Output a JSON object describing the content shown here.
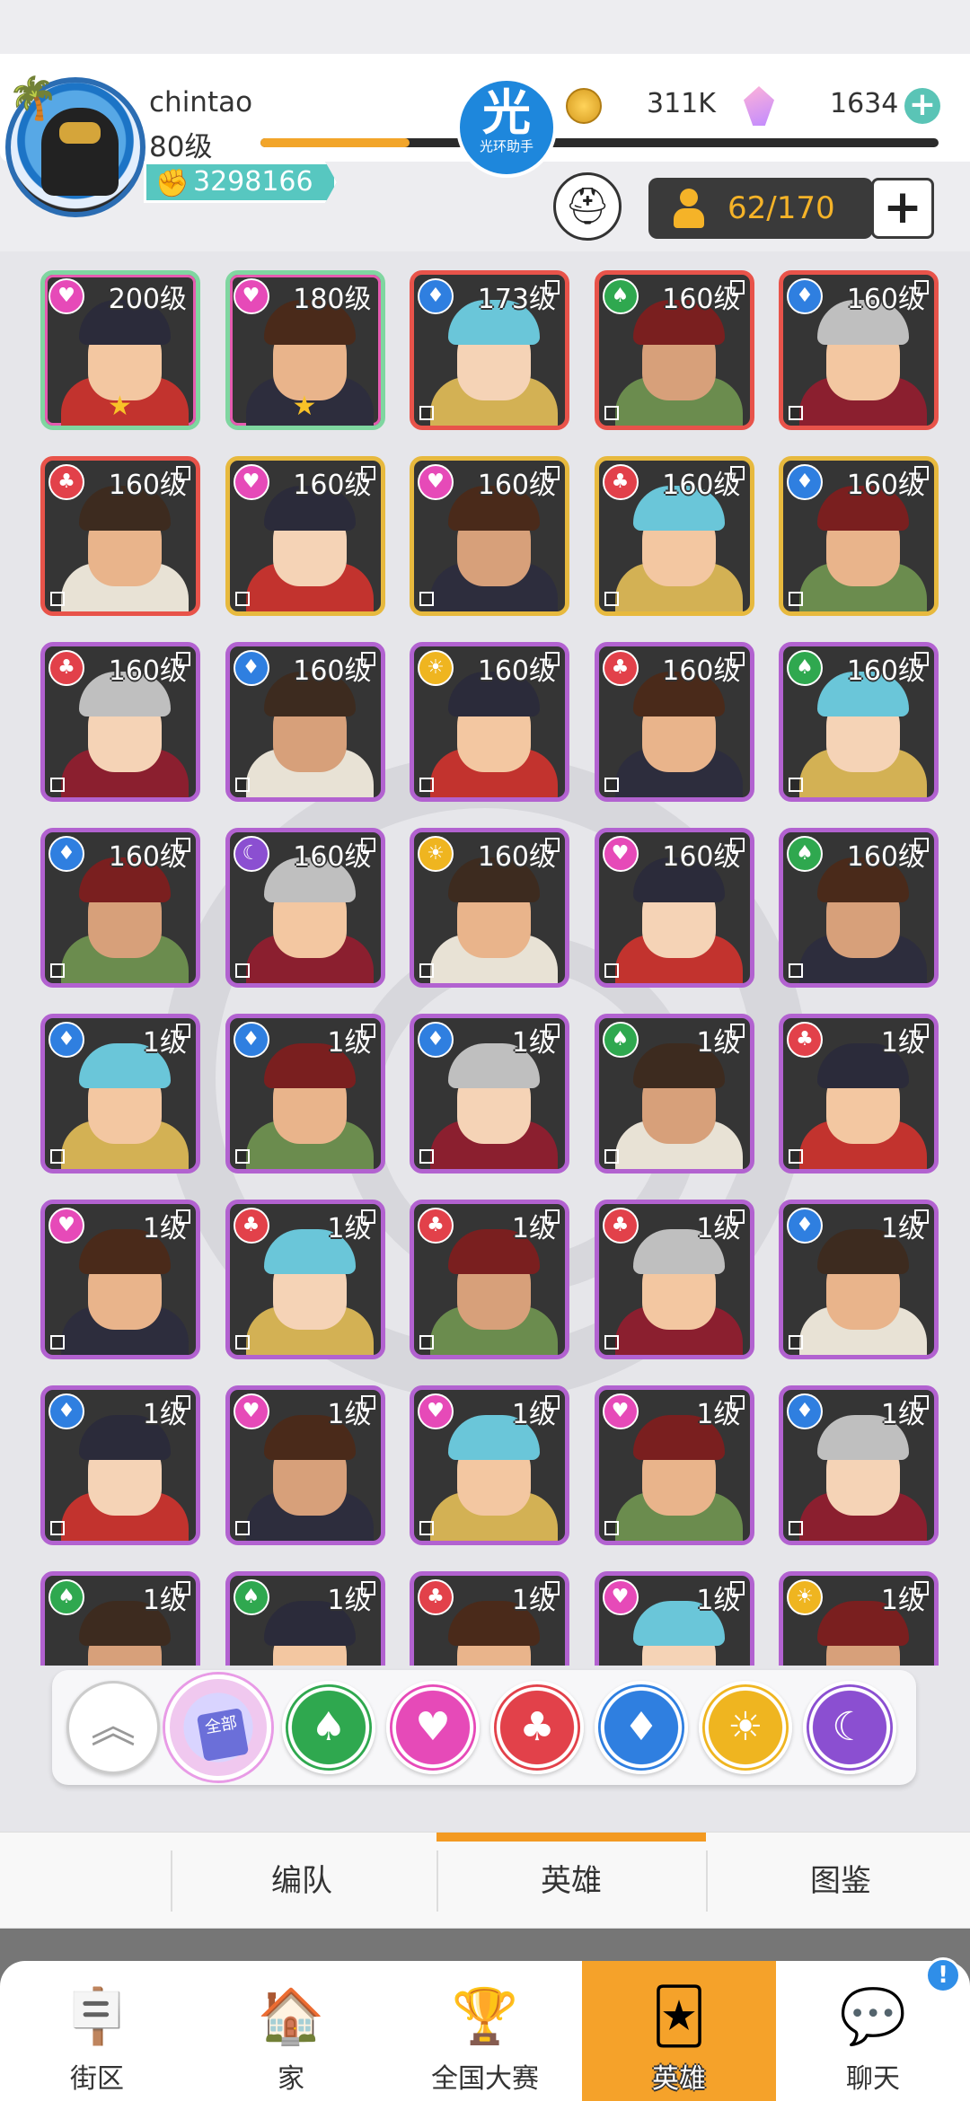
{
  "colors": {
    "accent_orange": "#f39a22",
    "xp_fill": "#f2a52a",
    "rarity_orange": "#e8534a",
    "rarity_gold": "#e7b93e",
    "rarity_purple": "#b262d0",
    "rarity_rainbow": "#7fd6a0"
  },
  "header": {
    "username": "chintao",
    "level": "80级",
    "power": "3298166",
    "xp_progress": 0.22,
    "helper_logo": {
      "big": "光",
      "small": "光环助手"
    },
    "coins": "311K",
    "gems": "1634",
    "hero_count": "62/170"
  },
  "heroes": [
    {
      "level": "200级",
      "element": "heart",
      "rarity": "rainbow",
      "stars": "★"
    },
    {
      "level": "180级",
      "element": "heart",
      "rarity": "rainbow",
      "stars": "★"
    },
    {
      "level": "173级",
      "element": "diamond",
      "rarity": "orange",
      "stars": ""
    },
    {
      "level": "160级",
      "element": "spade",
      "rarity": "orange",
      "stars": ""
    },
    {
      "level": "160级",
      "element": "diamond",
      "rarity": "orange",
      "stars": ""
    },
    {
      "level": "160级",
      "element": "club",
      "rarity": "orange",
      "stars": ""
    },
    {
      "level": "160级",
      "element": "heart",
      "rarity": "gold",
      "stars": ""
    },
    {
      "level": "160级",
      "element": "heart",
      "rarity": "gold",
      "stars": ""
    },
    {
      "level": "160级",
      "element": "club",
      "rarity": "gold",
      "stars": ""
    },
    {
      "level": "160级",
      "element": "diamond",
      "rarity": "gold",
      "stars": ""
    },
    {
      "level": "160级",
      "element": "club",
      "rarity": "purple",
      "stars": ""
    },
    {
      "level": "160级",
      "element": "diamond",
      "rarity": "purple",
      "stars": ""
    },
    {
      "level": "160级",
      "element": "sun",
      "rarity": "purple",
      "stars": ""
    },
    {
      "level": "160级",
      "element": "club",
      "rarity": "purple",
      "stars": ""
    },
    {
      "level": "160级",
      "element": "spade",
      "rarity": "purple",
      "stars": ""
    },
    {
      "level": "160级",
      "element": "diamond",
      "rarity": "purple",
      "stars": ""
    },
    {
      "level": "160级",
      "element": "moon",
      "rarity": "purple",
      "stars": ""
    },
    {
      "level": "160级",
      "element": "sun",
      "rarity": "purple",
      "stars": ""
    },
    {
      "level": "160级",
      "element": "heart",
      "rarity": "purple",
      "stars": ""
    },
    {
      "level": "160级",
      "element": "spade",
      "rarity": "purple",
      "stars": ""
    },
    {
      "level": "1级",
      "element": "diamond",
      "rarity": "purple",
      "stars": ""
    },
    {
      "level": "1级",
      "element": "diamond",
      "rarity": "purple",
      "stars": ""
    },
    {
      "level": "1级",
      "element": "diamond",
      "rarity": "purple",
      "stars": ""
    },
    {
      "level": "1级",
      "element": "spade",
      "rarity": "purple",
      "stars": ""
    },
    {
      "level": "1级",
      "element": "club",
      "rarity": "purple",
      "stars": ""
    },
    {
      "level": "1级",
      "element": "heart",
      "rarity": "purple",
      "stars": ""
    },
    {
      "level": "1级",
      "element": "club",
      "rarity": "purple",
      "stars": ""
    },
    {
      "level": "1级",
      "element": "club",
      "rarity": "purple",
      "stars": ""
    },
    {
      "level": "1级",
      "element": "club",
      "rarity": "purple",
      "stars": ""
    },
    {
      "level": "1级",
      "element": "diamond",
      "rarity": "purple",
      "stars": ""
    },
    {
      "level": "1级",
      "element": "diamond",
      "rarity": "purple",
      "stars": ""
    },
    {
      "level": "1级",
      "element": "heart",
      "rarity": "purple",
      "stars": ""
    },
    {
      "level": "1级",
      "element": "heart",
      "rarity": "purple",
      "stars": ""
    },
    {
      "level": "1级",
      "element": "heart",
      "rarity": "purple",
      "stars": ""
    },
    {
      "level": "1级",
      "element": "diamond",
      "rarity": "purple",
      "stars": ""
    },
    {
      "level": "1级",
      "element": "spade",
      "rarity": "purple",
      "stars": ""
    },
    {
      "level": "1级",
      "element": "spade",
      "rarity": "purple",
      "stars": ""
    },
    {
      "level": "1级",
      "element": "club",
      "rarity": "purple",
      "stars": ""
    },
    {
      "level": "1级",
      "element": "heart",
      "rarity": "purple",
      "stars": ""
    },
    {
      "level": "1级",
      "element": "sun",
      "rarity": "purple",
      "stars": ""
    }
  ],
  "filters": {
    "all_label": "全部",
    "elements": [
      {
        "name": "spade",
        "glyph": "♠",
        "color": "#2fa84f"
      },
      {
        "name": "heart",
        "glyph": "♥",
        "color": "#e64ab8"
      },
      {
        "name": "club",
        "glyph": "♣",
        "color": "#e2414a"
      },
      {
        "name": "diamond",
        "glyph": "♦",
        "color": "#2f7fe0"
      },
      {
        "name": "sun",
        "glyph": "☀",
        "color": "#efb520"
      },
      {
        "name": "moon",
        "glyph": "☾",
        "color": "#8b4fd1"
      }
    ]
  },
  "subtabs": [
    {
      "label": "编队"
    },
    {
      "label": "英雄"
    },
    {
      "label": "图鉴"
    }
  ],
  "nav": [
    {
      "label": "街区",
      "icon": "signpost-icon"
    },
    {
      "label": "家",
      "icon": "house-icon"
    },
    {
      "label": "全国大赛",
      "icon": "trophy-icon"
    },
    {
      "label": "英雄",
      "icon": "hero-cards-icon"
    },
    {
      "label": "聊天",
      "icon": "chat-bubble-icon"
    }
  ],
  "chat_badge": "!"
}
